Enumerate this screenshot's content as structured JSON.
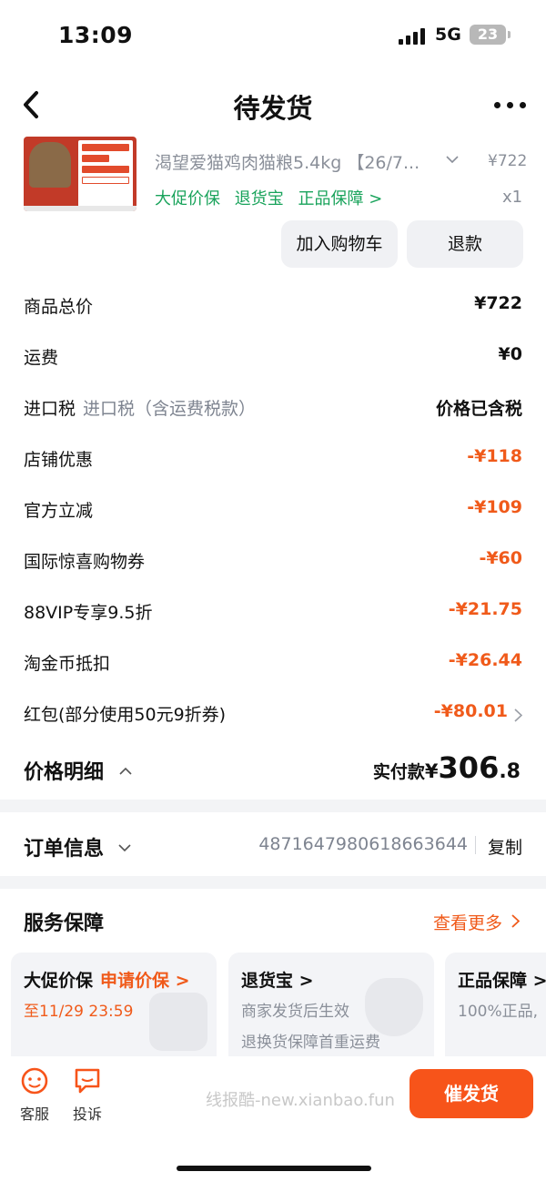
{
  "status": {
    "time": "13:09",
    "network": "5G",
    "battery": "23"
  },
  "nav": {
    "title": "待发货"
  },
  "product": {
    "title": "渴望爱猫鸡肉猫粮5.4kg 【26/7...",
    "price": "¥722",
    "tags": [
      "大促价保",
      "退货宝",
      "正品保障 >"
    ],
    "qty": "x1",
    "image_icon": "cat-food-package-image",
    "image_text": {
      "brand": "Orijen",
      "line1": "成长期以及营养丰富的猫粮",
      "badge": "85",
      "promo": "0元入会折上折",
      "v1": "10",
      "v2": "20",
      "name": "Original Cat"
    }
  },
  "actions": {
    "add_to_cart": "加入购物车",
    "refund": "退款"
  },
  "costs": [
    {
      "label": "商品总价",
      "sub": "",
      "value": "¥722",
      "orange": false
    },
    {
      "label": "运费",
      "sub": "",
      "value": "¥0",
      "orange": false
    },
    {
      "label": "进口税",
      "sub": "进口税（含运费税款）",
      "value": "价格已含税",
      "orange": false
    },
    {
      "label": "店铺优惠",
      "sub": "",
      "value": "-¥118",
      "orange": true
    },
    {
      "label": "官方立减",
      "sub": "",
      "value": "-¥109",
      "orange": true
    },
    {
      "label": "国际惊喜购物券",
      "sub": "",
      "value": "-¥60",
      "orange": true
    },
    {
      "label": "88VIP专享9.5折",
      "sub": "",
      "value": "-¥21.75",
      "orange": true
    },
    {
      "label": "淘金币抵扣",
      "sub": "",
      "value": "-¥26.44",
      "orange": true
    },
    {
      "label": "红包(部分使用50元9折券)",
      "sub": "",
      "value": "-¥80.01",
      "orange": true
    }
  ],
  "summary": {
    "title": "价格明细",
    "paid_label": "实付款",
    "currency": "¥",
    "amount_int": "306",
    "amount_dec": ".8"
  },
  "order": {
    "title": "订单信息",
    "number": "4871647980618663644",
    "copy": "复制"
  },
  "service": {
    "title": "服务保障",
    "more": "查看更多",
    "cards": [
      {
        "title": "大促价保",
        "action": "申请价保 >",
        "line1": "至11/29 23:59",
        "line2": ""
      },
      {
        "title": "退货宝 >",
        "action": "",
        "line1": "商家发货后生效",
        "line2": "退换货保障首重运费"
      },
      {
        "title": "正品保障 >",
        "action": "",
        "line1": "100%正品,",
        "line2": ""
      }
    ]
  },
  "bottom": {
    "service": "客服",
    "complaint": "投诉",
    "watermark": "线报酷-new.xianbao.fun",
    "urge": "催发货"
  },
  "colors": {
    "accent": "#f05a1a",
    "green": "#19a35b",
    "button": "#f7541a"
  }
}
